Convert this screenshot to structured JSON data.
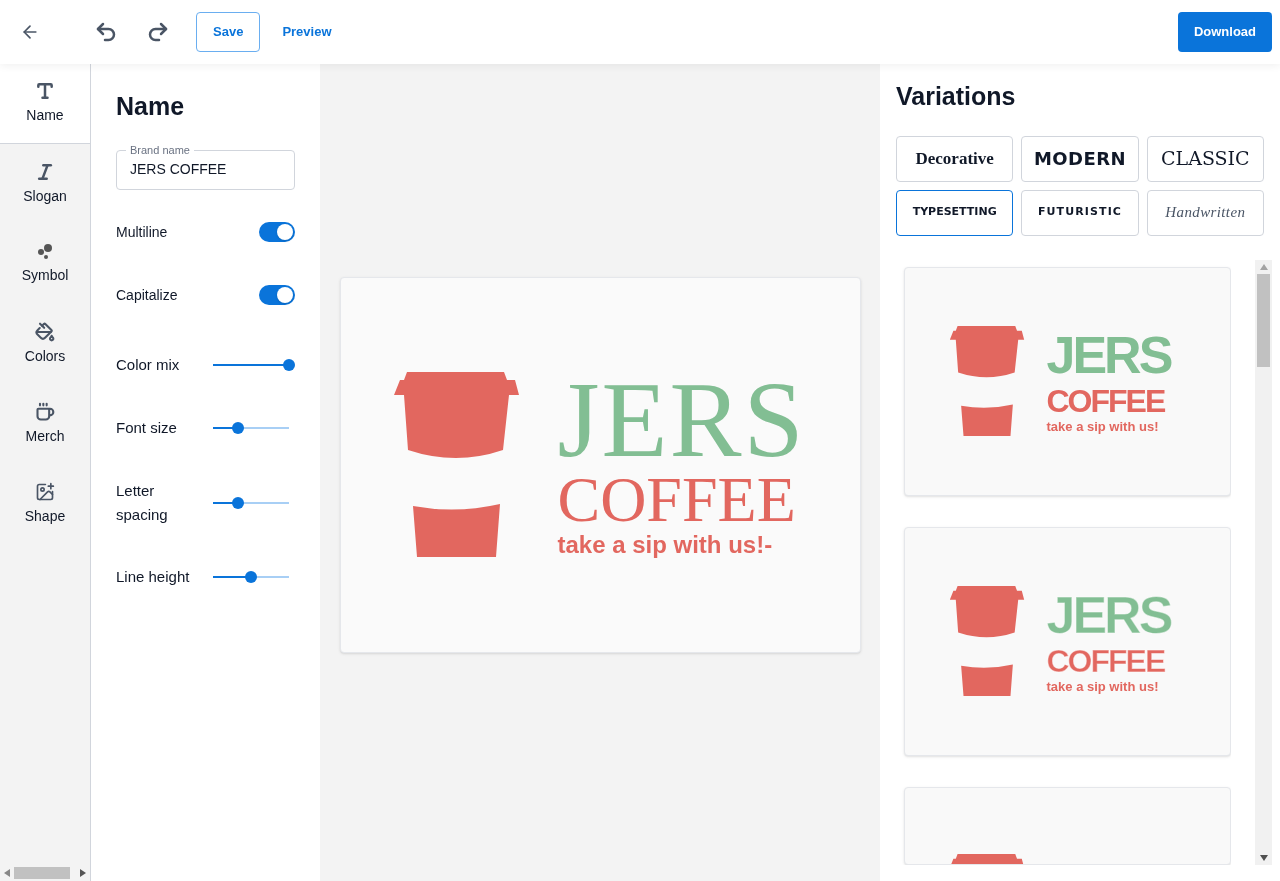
{
  "toolbar": {
    "save": "Save",
    "preview": "Preview",
    "download": "Download"
  },
  "sidebar": {
    "items": [
      {
        "label": "Name",
        "kind": "text",
        "selected": true
      },
      {
        "label": "Slogan",
        "kind": "italic",
        "selected": false
      },
      {
        "label": "Symbol",
        "kind": "dots",
        "selected": false
      },
      {
        "label": "Colors",
        "kind": "bucket",
        "selected": false
      },
      {
        "label": "Merch",
        "kind": "mug",
        "selected": false
      },
      {
        "label": "Shape",
        "kind": "image",
        "selected": false
      }
    ]
  },
  "panel": {
    "title": "Name",
    "field": {
      "label": "Brand name",
      "value": "JERS COFFEE"
    },
    "toggles": [
      {
        "label": "Multiline",
        "on": true
      },
      {
        "label": "Capitalize",
        "on": true
      }
    ],
    "sliders": [
      {
        "label": "Color mix",
        "level": 1
      },
      {
        "label": "Font size",
        "level": 0.33
      },
      {
        "label": "Letter spacing",
        "level": 0.33
      },
      {
        "label": "Line height",
        "level": 0.5
      }
    ]
  },
  "preview": {
    "name_top": "JERS",
    "name_bottom": "COFFEE",
    "slogan": "take a sip with us!-"
  },
  "variations": {
    "title": "Variations",
    "styles": [
      {
        "label": "Decorative",
        "kind": "decorative",
        "selected": false
      },
      {
        "label": "MODERN",
        "kind": "modern",
        "selected": false
      },
      {
        "label": "CLASSIC",
        "kind": "classic",
        "selected": false
      },
      {
        "label": "TYPESETTING",
        "kind": "typesetting",
        "selected": true
      },
      {
        "label": "FUTURISTIC",
        "kind": "futuristic",
        "selected": false
      },
      {
        "label": "Handwritten",
        "kind": "handwritten",
        "selected": false
      }
    ],
    "cards": [
      {
        "name_top": "JERS",
        "name_bottom": "COFFEE",
        "slogan": "take a sip with us!",
        "kind": "solid"
      },
      {
        "name_top": "JERS",
        "name_bottom": "COFFEE",
        "slogan": "take a sip with us!",
        "kind": "inline"
      },
      {
        "kind": "cut"
      }
    ]
  }
}
